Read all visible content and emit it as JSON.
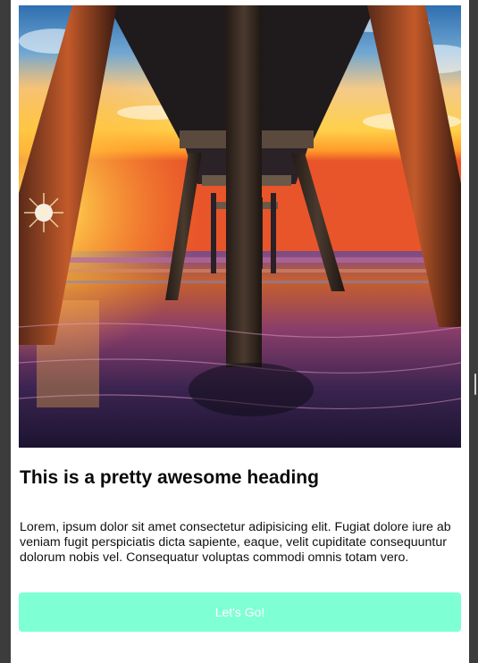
{
  "card": {
    "image_alt": "Sunset beneath a wooden pier over the ocean",
    "heading": "This is a pretty awesome heading",
    "body": "Lorem, ipsum dolor sit amet consectetur adipisicing elit. Fugiat dolore iure ab veniam fugit perspiciatis dicta sapiente, eaque, velit cupiditate consequuntur dolorum nobis vel. Consequatur voluptas commodi omnis totam vero.",
    "button_label": "Let's Go!"
  },
  "colors": {
    "button_bg": "#7fffd4",
    "page_bg": "#3c3c3c",
    "card_bg": "#ffffff"
  }
}
